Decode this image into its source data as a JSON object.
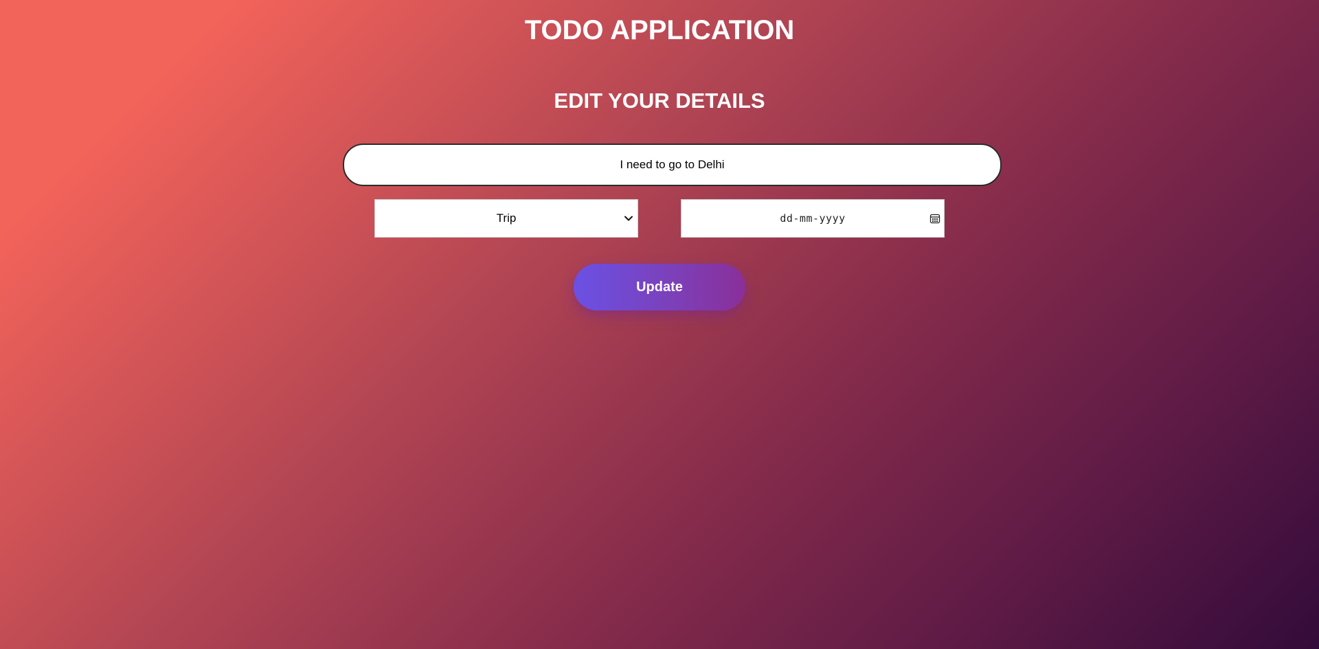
{
  "app": {
    "title": "TODO APPLICATION"
  },
  "form": {
    "heading": "EDIT YOUR DETAILS",
    "task": {
      "value": "I need to go to Delhi"
    },
    "category": {
      "selected": "Trip",
      "icon": "chevron-down-icon"
    },
    "date": {
      "placeholder": "dd-mm-yyyy",
      "icon": "calendar-icon"
    },
    "submit_label": "Update"
  },
  "colors": {
    "background_start": "#f2635a",
    "background_end": "#330b3a",
    "button_start": "#6a51e4",
    "button_end": "#8a2f9a",
    "text": "#ffffff"
  }
}
